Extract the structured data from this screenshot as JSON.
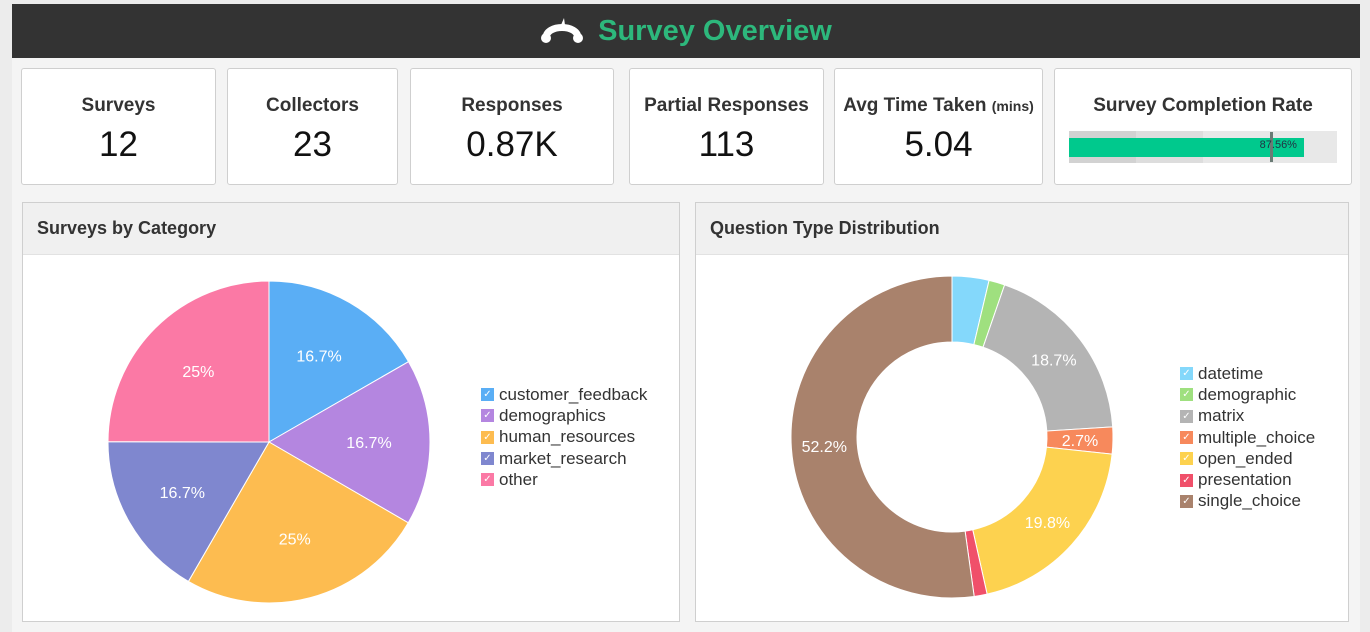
{
  "header": {
    "title": "Survey Overview",
    "logo_icon": "surveymonkey-logo-icon"
  },
  "kpis": [
    {
      "label": "Surveys",
      "value": "12"
    },
    {
      "label": "Collectors",
      "value": "23"
    },
    {
      "label": "Responses",
      "value": "0.87K"
    },
    {
      "label": "Partial Responses",
      "value": "113"
    },
    {
      "label": "Avg Time Taken",
      "unit": "(mins)",
      "value": "5.04"
    }
  ],
  "completion": {
    "label": "Survey Completion Rate",
    "value_text": "87.56%",
    "value": 87.56,
    "target": 75,
    "color": "#00c98d"
  },
  "chart_data": [
    {
      "type": "pie",
      "title": "Surveys by Category",
      "categories": [
        "customer_feedback",
        "demographics",
        "human_resources",
        "market_research",
        "other"
      ],
      "values": [
        16.7,
        16.7,
        25,
        16.7,
        25
      ],
      "labels": [
        "16.7%",
        "16.7%",
        "25%",
        "16.7%",
        "25%"
      ],
      "colors": [
        "#5aaef5",
        "#b486e0",
        "#fdbc50",
        "#7f87cf",
        "#fb79a5"
      ],
      "legend": "right"
    },
    {
      "type": "pie",
      "subtype": "donut",
      "title": "Question Type Distribution",
      "categories": [
        "datetime",
        "demographic",
        "matrix",
        "multiple_choice",
        "open_ended",
        "presentation",
        "single_choice"
      ],
      "values": [
        3.7,
        1.6,
        18.7,
        2.7,
        19.8,
        1.3,
        52.2
      ],
      "labels": [
        "",
        "",
        "18.7%",
        "2.7%",
        "19.8%",
        "",
        "52.2%"
      ],
      "colors": [
        "#84d8fb",
        "#9fe07f",
        "#b4b4b4",
        "#f7895c",
        "#fdd24f",
        "#f0506a",
        "#a9826c"
      ],
      "legend": "right"
    }
  ]
}
